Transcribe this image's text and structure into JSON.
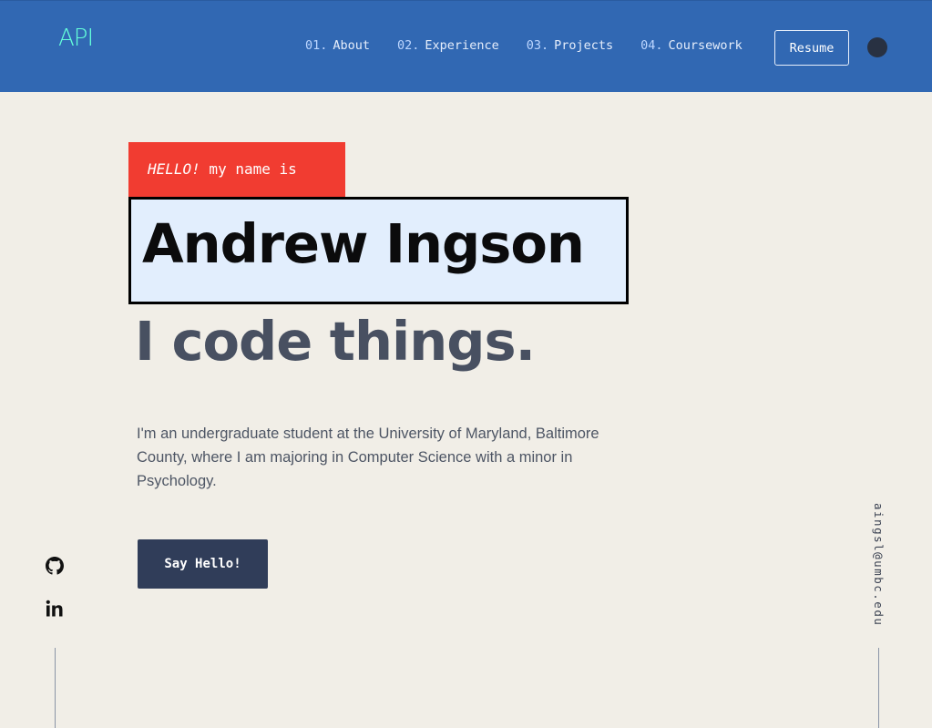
{
  "header": {
    "logo_text": "API",
    "nav": [
      {
        "num": "01.",
        "label": "About"
      },
      {
        "num": "02.",
        "label": "Experience"
      },
      {
        "num": "03.",
        "label": "Projects"
      },
      {
        "num": "04.",
        "label": "Coursework"
      }
    ],
    "resume_label": "Resume",
    "theme_toggle_icon": "dark-mode-toggle-icon"
  },
  "hero": {
    "greeting_emphasis": "HELLO!",
    "greeting_rest": " my name is",
    "name": "Andrew Ingson",
    "tagline": "I code things.",
    "intro": "I'm an undergraduate student at the University of Maryland, Baltimore County, where I am majoring in Computer Science with a minor in Psychology.",
    "cta_label": "Say Hello!"
  },
  "social": {
    "links": [
      {
        "icon": "github-icon"
      },
      {
        "icon": "linkedin-icon"
      }
    ]
  },
  "email": "aingsl@umbc.edu",
  "colors": {
    "header_bg": "#3168b3",
    "logo": "#64ffda",
    "page_bg": "#f1eee7",
    "greeting_bg": "#f13c31",
    "name_box_bg": "#e2eefd",
    "cta_bg": "#303d59"
  }
}
